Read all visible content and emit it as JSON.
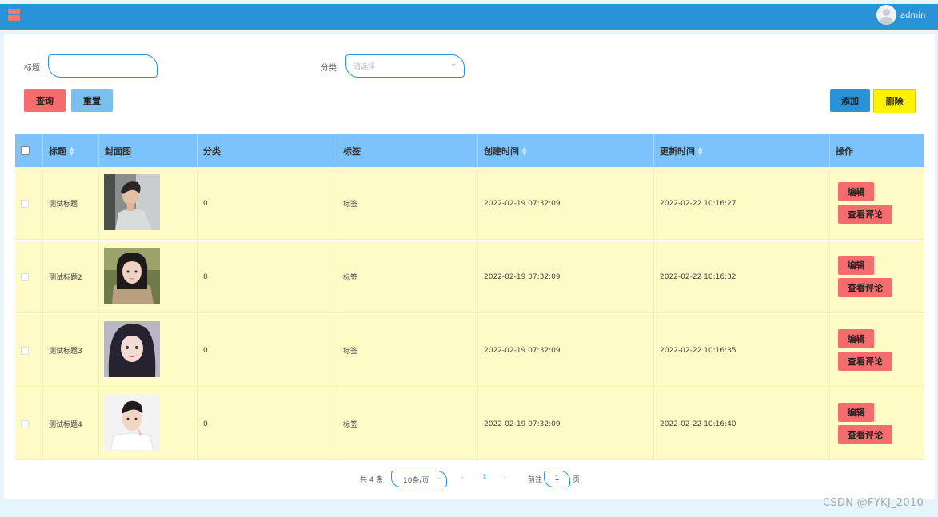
{
  "header": {
    "user": "admin"
  },
  "search": {
    "title_label": "标题",
    "title_value": "",
    "category_label": "分类",
    "category_placeholder": "请选择",
    "query_label": "查询",
    "reset_label": "重置",
    "add_label": "添加",
    "delete_label": "删除"
  },
  "table": {
    "columns": [
      "标题",
      "封面图",
      "分类",
      "标签",
      "创建时间",
      "更新时间",
      "操作"
    ],
    "rows": [
      {
        "title": "测试标题",
        "category": "0",
        "tag": "标签",
        "created": "2022-02-19 07:32:09",
        "updated": "2022-02-22 10:16:27"
      },
      {
        "title": "测试标题2",
        "category": "0",
        "tag": "标签",
        "created": "2022-02-19 07:32:09",
        "updated": "2022-02-22 10:16:32"
      },
      {
        "title": "测试标题3",
        "category": "0",
        "tag": "标签",
        "created": "2022-02-19 07:32:09",
        "updated": "2022-02-22 10:16:35"
      },
      {
        "title": "测试标题4",
        "category": "0",
        "tag": "标签",
        "created": "2022-02-19 07:32:09",
        "updated": "2022-02-22 10:16:40"
      }
    ],
    "edit_label": "编辑",
    "comments_label": "查看评论"
  },
  "pagination": {
    "total": "共 4 条",
    "page_size": "10条/页",
    "current": "1",
    "goto_label": "前往",
    "goto_value": "1",
    "page_suffix": "页"
  },
  "watermark": "CSDN @FYKJ_2010"
}
